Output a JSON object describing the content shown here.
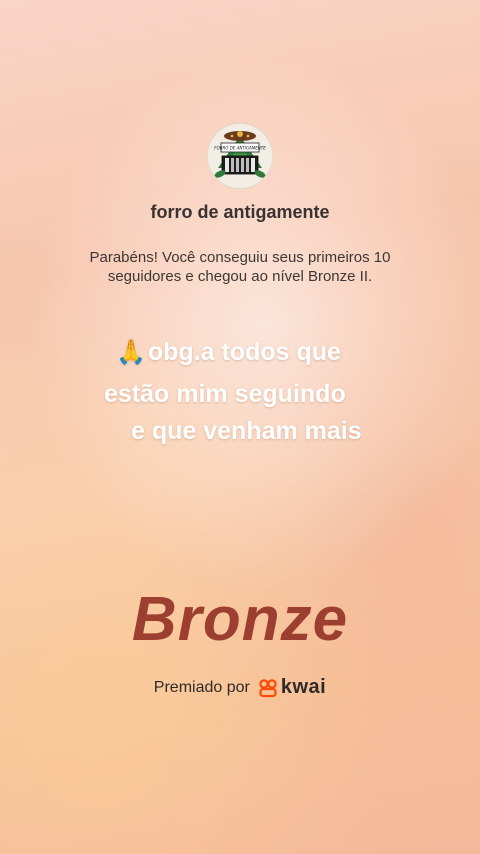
{
  "profile": {
    "username": "forro de antigamente",
    "avatar_icon": "accordion-logo-icon",
    "avatar_text": "FORRÓ DE ANTIGAMENTE"
  },
  "notification": {
    "message": "Parabéns! Você conseguiu seus primeiros 10 seguidores e chegou ao nível Bronze II."
  },
  "overlay_text": {
    "emoji": "🙏",
    "line1": "obg.a todos que",
    "line2": "estão mim seguindo",
    "line3": "e que venham mais"
  },
  "level": {
    "name": "Bronze",
    "color": "#9c3f30"
  },
  "footer": {
    "awarded_by": "Premiado por",
    "brand": "kwai",
    "brand_color": "#ff4906"
  }
}
